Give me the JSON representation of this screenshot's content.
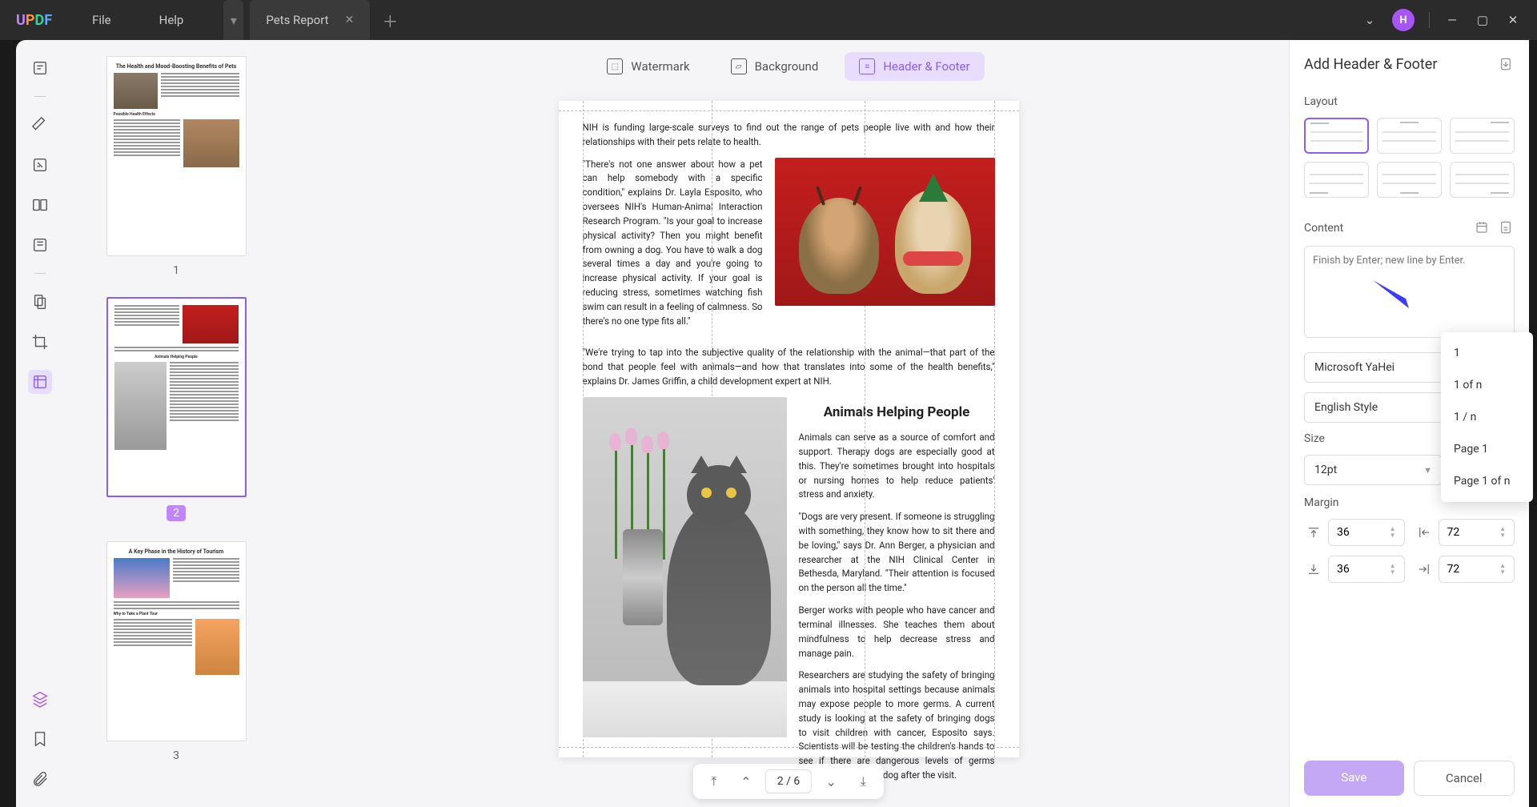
{
  "titlebar": {
    "menu": {
      "file": "File",
      "help": "Help"
    },
    "tab": {
      "title": "Pets Report"
    },
    "avatar": "H"
  },
  "doc_tabs": {
    "watermark": "Watermark",
    "background": "Background",
    "header_footer": "Header & Footer"
  },
  "thumbnails": {
    "p1_title": "The Health and Mood-Boosting Benefits of Pets",
    "p1_sub": "Possible Health Effects",
    "p1_num": "1",
    "p2_sub": "Animals Helping People",
    "p2_num": "2",
    "p3_title": "A Key Phase in the History of Tourism",
    "p3_sub": "Why to Take a Plant Tour",
    "p3_num": "3"
  },
  "document": {
    "para_top": "NIH is funding large-scale surveys to find out the range of pets people live with and how their relationships with their pets relate to health.",
    "para_quote1": "\"There's not one answer about how a pet can help somebody with a specific condition,\" explains Dr. Layla Esposito, who oversees NIH's Human-Animal Interaction Research Program. \"Is your goal to increase physical activity? Then you might benefit from owning a dog. You have to walk a dog several times a day and you're going to increase physical activity. If your goal is reducing stress, sometimes watching fish swim can result in a feeling of calmness. So there's no one type fits all.\"",
    "para_quote2": "\"We're trying to tap into the subjective quality of the relationship with the animal—that part of the bond that people feel with animals—and how that translates into some of the health benefits,\" explains Dr. James Griffin, a child development expert at NIH.",
    "h2": "Animals Helping People",
    "para_a1": "Animals can serve as a source of comfort and support. Therapy dogs are especially good at this. They're sometimes brought into hospitals or nursing homes to help reduce patients' stress and anxiety.",
    "para_a2": "\"Dogs are very present. If someone is struggling with something, they know how to sit there and be loving,\" says Dr. Ann Berger, a physician and researcher at the NIH Clinical Center in Bethesda, Maryland. \"Their attention is focused on the person all the time.\"",
    "para_a3": "Berger works with people who have cancer and terminal illnesses. She teaches them about mindfulness to help decrease stress and manage pain.",
    "para_a4": "Researchers are studying the safety of bringing animals into hospital settings because animals may expose people to more germs. A current study is looking at the safety of bringing dogs to visit children with cancer, Esposito says. Scientists will be testing the children's hands to see if there are dangerous levels of germs transferred from the dog after the visit."
  },
  "page_nav": {
    "label": "2 / 6"
  },
  "panel": {
    "title": "Add Header & Footer",
    "layout": "Layout",
    "content": "Content",
    "content_placeholder": "Finish by Enter; new line by Enter.",
    "font": "Microsoft YaHei",
    "style": "English Style",
    "size_label": "Size",
    "size_value": "12pt",
    "margin_label": "Margin",
    "m_top": "36",
    "m_bottom": "36",
    "m_left": "72",
    "m_right": "72",
    "save": "Save",
    "cancel": "Cancel",
    "menu": {
      "o1": "1",
      "o2": "1 of n",
      "o3": "1 / n",
      "o4": "Page 1",
      "o5": "Page 1 of n"
    }
  }
}
